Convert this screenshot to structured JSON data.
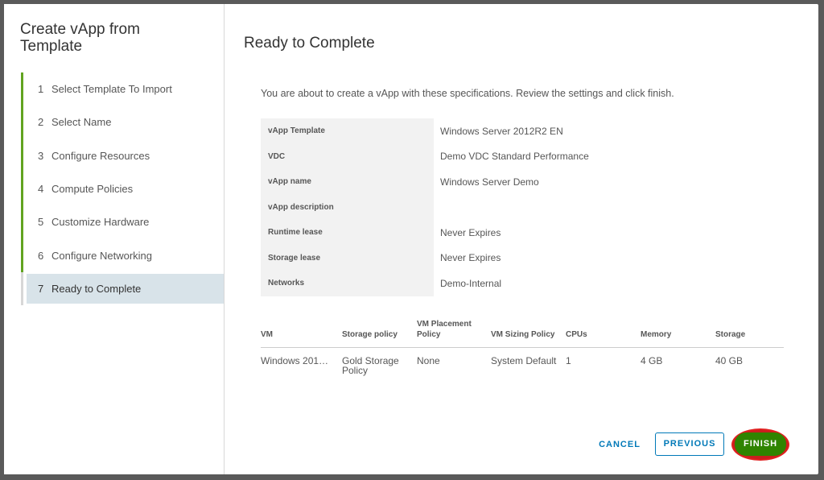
{
  "wizard": {
    "title": "Create vApp from Template",
    "steps": [
      {
        "num": "1",
        "label": "Select Template To Import"
      },
      {
        "num": "2",
        "label": "Select Name"
      },
      {
        "num": "3",
        "label": "Configure Resources"
      },
      {
        "num": "4",
        "label": "Compute Policies"
      },
      {
        "num": "5",
        "label": "Customize Hardware"
      },
      {
        "num": "6",
        "label": "Configure Networking"
      },
      {
        "num": "7",
        "label": "Ready to Complete"
      }
    ]
  },
  "page": {
    "title": "Ready to Complete",
    "intro": "You are about to create a vApp with these specifications. Review the settings and click finish."
  },
  "specs": [
    {
      "key": "vApp Template",
      "value": "Windows Server 2012R2 EN"
    },
    {
      "key": "VDC",
      "value": "Demo VDC Standard Performance"
    },
    {
      "key": "vApp name",
      "value": "Windows Server Demo"
    },
    {
      "key": "vApp description",
      "value": ""
    },
    {
      "key": "Runtime lease",
      "value": "Never Expires"
    },
    {
      "key": "Storage lease",
      "value": "Never Expires"
    },
    {
      "key": "Networks",
      "value": "Demo-Internal"
    }
  ],
  "vm_table": {
    "headers": [
      "VM",
      "Storage policy",
      "VM Placement Policy",
      "VM Sizing Policy",
      "CPUs",
      "Memory",
      "Storage"
    ],
    "rows": [
      [
        "Windows 201…",
        "Gold Storage Policy",
        "None",
        "System Default",
        "1",
        "4 GB",
        "40 GB"
      ]
    ]
  },
  "buttons": {
    "cancel": "CANCEL",
    "previous": "PREVIOUS",
    "finish": "FINISH"
  },
  "colors": {
    "accent_blue": "#0079b8",
    "step_done": "#62a420",
    "finish_green": "#2f8400",
    "highlight_red": "#e02020"
  }
}
